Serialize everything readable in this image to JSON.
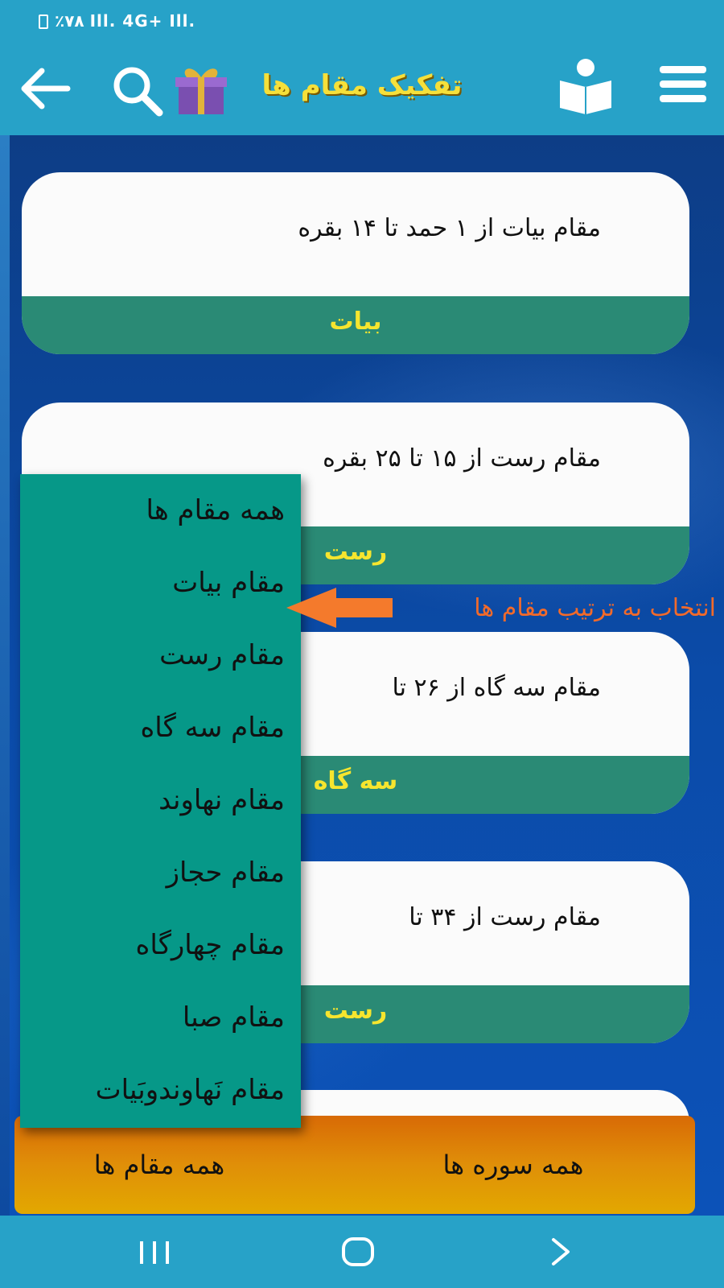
{
  "status_bar": {
    "text": "٪۷۸ Ill. 4G+ Ill."
  },
  "app_bar": {
    "title": "تفکیک مقام ها",
    "icons": [
      "back-arrow-icon",
      "search-icon",
      "gift-icon",
      "book-reader-icon",
      "hamburger-menu-icon"
    ]
  },
  "cards": [
    {
      "text": "مقام بیات  از  ۱ حمد تا ۱۴  بقره",
      "footer": "بیات"
    },
    {
      "text": "مقام رست   از  ۱۵  تا  ۲۵  بقره",
      "footer": "رست"
    },
    {
      "text": "مقام سه گاه  از  ۲۶  تا",
      "footer": "سه گاه"
    },
    {
      "text": "مقام رست  از  ۳۴  تا",
      "footer": "رست"
    }
  ],
  "dropdown": {
    "items": [
      "همه مقام ها",
      "مقام بیات",
      "مقام رست",
      "مقام سه گاه",
      "مقام نهاوند",
      "مقام حجاز",
      "مقام چهارگاه",
      "مقام صبا",
      "مقام نَهاوندوبَیات"
    ]
  },
  "annotation": {
    "text": "انتخاب به ترتیب مقام ها",
    "color": "#f26a2a"
  },
  "bottom_bar": {
    "left_label": "همه مقام ها",
    "right_label": "همه سوره ها"
  },
  "colors": {
    "app_bar": "#27a2c8",
    "card_footer": "#2a8a75",
    "footer_text": "#f6e52e",
    "dropdown": "#069888",
    "title": "#f6e03a"
  }
}
